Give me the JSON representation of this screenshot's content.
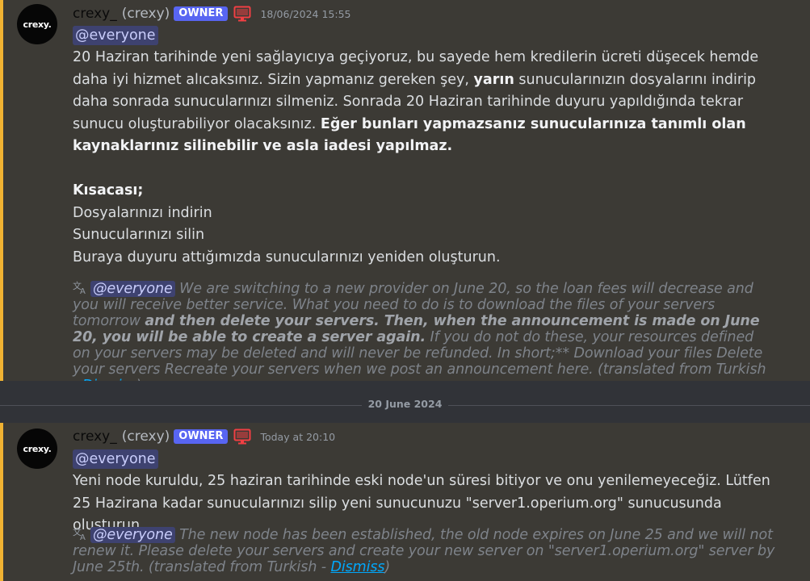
{
  "messages": [
    {
      "avatar_text": "crexy.",
      "author": "crexy_",
      "username": "(crexy)",
      "badge": "OWNER",
      "timestamp": "18/06/2024 15:55",
      "mention": "@everyone",
      "body": {
        "p1_a": "20 Haziran tarihinde yeni sağlayıcıya geçiyoruz, bu sayede hem kredilerin ücreti düşecek hemde daha iyi hizmet alıcaksınız. Sizin yapmanız gereken şey, ",
        "p1_bold": "yarın",
        "p1_b": " sunucularınızın dosyalarını indirip daha sonrada sunucularınızı silmeniz. Sonrada 20 Haziran tarihinde duyuru yapıldığında tekrar sunucu oluşturabiliyor olacaksınız. ",
        "p1_bold2": "Eğer bunları yapmazsanız sunucularınıza tanımlı olan kaynaklarınız silinebilir ve asla iadesi yapılmaz.",
        "summary_title": "Kısacası;",
        "line1": "Dosyalarınızı indirin",
        "line2": "Sunucularınızı silin",
        "line3": "Buraya duyuru attığımızda sunucularınızı yeniden oluşturun."
      },
      "translation": {
        "mention": "@everyone",
        "t1": " We are switching to a new provider on June 20, so the loan fees will decrease and you will receive better service. What you need to do is to download the files of your servers tomorrow ",
        "t_bold": "and then delete your servers. Then, when the announcement is made on June 20, you will be able to create a server again.",
        "t2": " If you do not do these, your resources defined on your servers may be deleted and will never be refunded. In short;** Download your files Delete your servers Recreate your servers when we post an announcement here. (translated from Turkish - ",
        "dismiss": "Dismiss",
        "close": ")"
      }
    },
    {
      "avatar_text": "crexy.",
      "author": "crexy_",
      "username": "(crexy)",
      "badge": "OWNER",
      "timestamp": "Today at 20:10",
      "mention": "@everyone",
      "body": "Yeni node kuruldu, 25 haziran tarihinde eski node'un süresi bitiyor ve onu yenilemeyeceğiz. Lütfen 25 Hazirana kadar sunucularınızı silip yeni sunucunuzu \"server1.operium.org\" sunucusunda oluşturun.",
      "translation": {
        "mention": "@everyone",
        "t1": " The new node has been established, the old node expires on June 25 and we will not renew it. Please delete your servers and create your new server on \"server1.operium.org\" server by June 25th. (translated from Turkish - ",
        "dismiss": "Dismiss",
        "close": ")"
      }
    }
  ],
  "divider": {
    "label": "20 June 2024"
  },
  "colors": {
    "owner_badge": "#5865f2",
    "highlight_border": "#f0b232",
    "mention_bg": "#3e4270",
    "link": "#00a8fc"
  },
  "icons": {
    "tag": "monitor-icon",
    "translate": "translate-icon"
  }
}
